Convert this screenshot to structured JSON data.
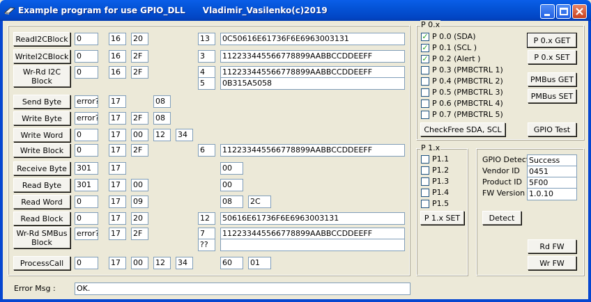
{
  "window": {
    "title": "Example program for use GPIO_DLL      Vladimir_Vasilenko(c)2019"
  },
  "smbus": {
    "rows": [
      {
        "label": "ReadI2CBlock",
        "f": [
          "0",
          "16",
          "20",
          "",
          "13",
          "0C50616E61736F6E6963003131"
        ]
      },
      {
        "label": "WriteI2CBlock",
        "f": [
          "0",
          "16",
          "2F",
          "",
          "3",
          "112233445566778899AABBCCDDEEFF"
        ]
      },
      {
        "label": "Wr-Rd I2C Block",
        "f": [
          "0",
          "16",
          "2F",
          "",
          "4",
          "112233445566778899AABBCCDDEEFF",
          "5",
          "0B315A5058"
        ]
      },
      {
        "label": "Send Byte",
        "f": [
          "error?",
          "17",
          "",
          "08"
        ]
      },
      {
        "label": "Write Byte",
        "f": [
          "error?",
          "17",
          "2F",
          "08"
        ]
      },
      {
        "label": "Write Word",
        "f": [
          "0",
          "17",
          "00",
          "12",
          "34"
        ]
      },
      {
        "label": "Write Block",
        "f": [
          "0",
          "17",
          "2F",
          "",
          "6",
          "112233445566778899AABBCCDDEEFF"
        ]
      },
      {
        "label": "Receive Byte",
        "f": [
          "301",
          "17",
          "",
          "",
          "",
          "00"
        ]
      },
      {
        "label": "Read Byte",
        "f": [
          "301",
          "17",
          "00",
          "",
          "",
          "00"
        ]
      },
      {
        "label": "Read Word",
        "f": [
          "0",
          "17",
          "09",
          "",
          "",
          "08",
          "2C"
        ]
      },
      {
        "label": "Read Block",
        "f": [
          "0",
          "17",
          "20",
          "",
          "12",
          "50616E61736F6E6963003131"
        ]
      },
      {
        "label": "Wr-Rd SMBus Block",
        "f": [
          "error?",
          "17",
          "2F",
          "",
          "7",
          "112233445566778899AABBCCDDEEFF",
          "??",
          ""
        ]
      },
      {
        "label": "ProcessCall",
        "f": [
          "0",
          "17",
          "00",
          "12",
          "34",
          "60",
          "01"
        ]
      }
    ]
  },
  "p0": {
    "title": "P 0.x",
    "pins": [
      {
        "label": "P 0.0  (SDA)",
        "checked": true
      },
      {
        "label": "P 0.1  (SCL )",
        "checked": true
      },
      {
        "label": "P 0.2  (Alert )",
        "checked": true
      },
      {
        "label": "P 0.3  (PMBCTRL 1)",
        "checked": false
      },
      {
        "label": "P 0.4  (PMBCTRL 2)",
        "checked": false
      },
      {
        "label": "P 0.5  (PMBCTRL 3)",
        "checked": false
      },
      {
        "label": "P 0.6  (PMBCTRL 4)",
        "checked": false
      },
      {
        "label": "P 0.7  (PMBCTRL 5)",
        "checked": false
      }
    ],
    "get": "P 0.x GET",
    "set": "P 0.x SET",
    "pmbus_get": "PMBus GET",
    "pmbus_set": "PMBus SET",
    "checkfree": "CheckFree SDA, SCL",
    "gpio_test": "GPIO Test"
  },
  "p1": {
    "title": "P 1.x",
    "pins": [
      {
        "label": "P1.1",
        "checked": false
      },
      {
        "label": "P1.2",
        "checked": false
      },
      {
        "label": "P1.3",
        "checked": false
      },
      {
        "label": "P1.4",
        "checked": false
      },
      {
        "label": "P1.5",
        "checked": false
      }
    ],
    "set": "P 1.x  SET"
  },
  "info": {
    "detect_label": "GPIO Detect",
    "detect_value": "Success",
    "vendor_label": "Vendor  ID",
    "vendor_value": "0451",
    "product_label": "Product ID",
    "product_value": "5F00",
    "fw_label": "FW Version",
    "fw_value": "1.0.10",
    "detect_btn": "Detect",
    "rd_fw": "Rd FW",
    "wr_fw": "Wr FW"
  },
  "error": {
    "label": "Error Msg :",
    "value": "OK."
  }
}
